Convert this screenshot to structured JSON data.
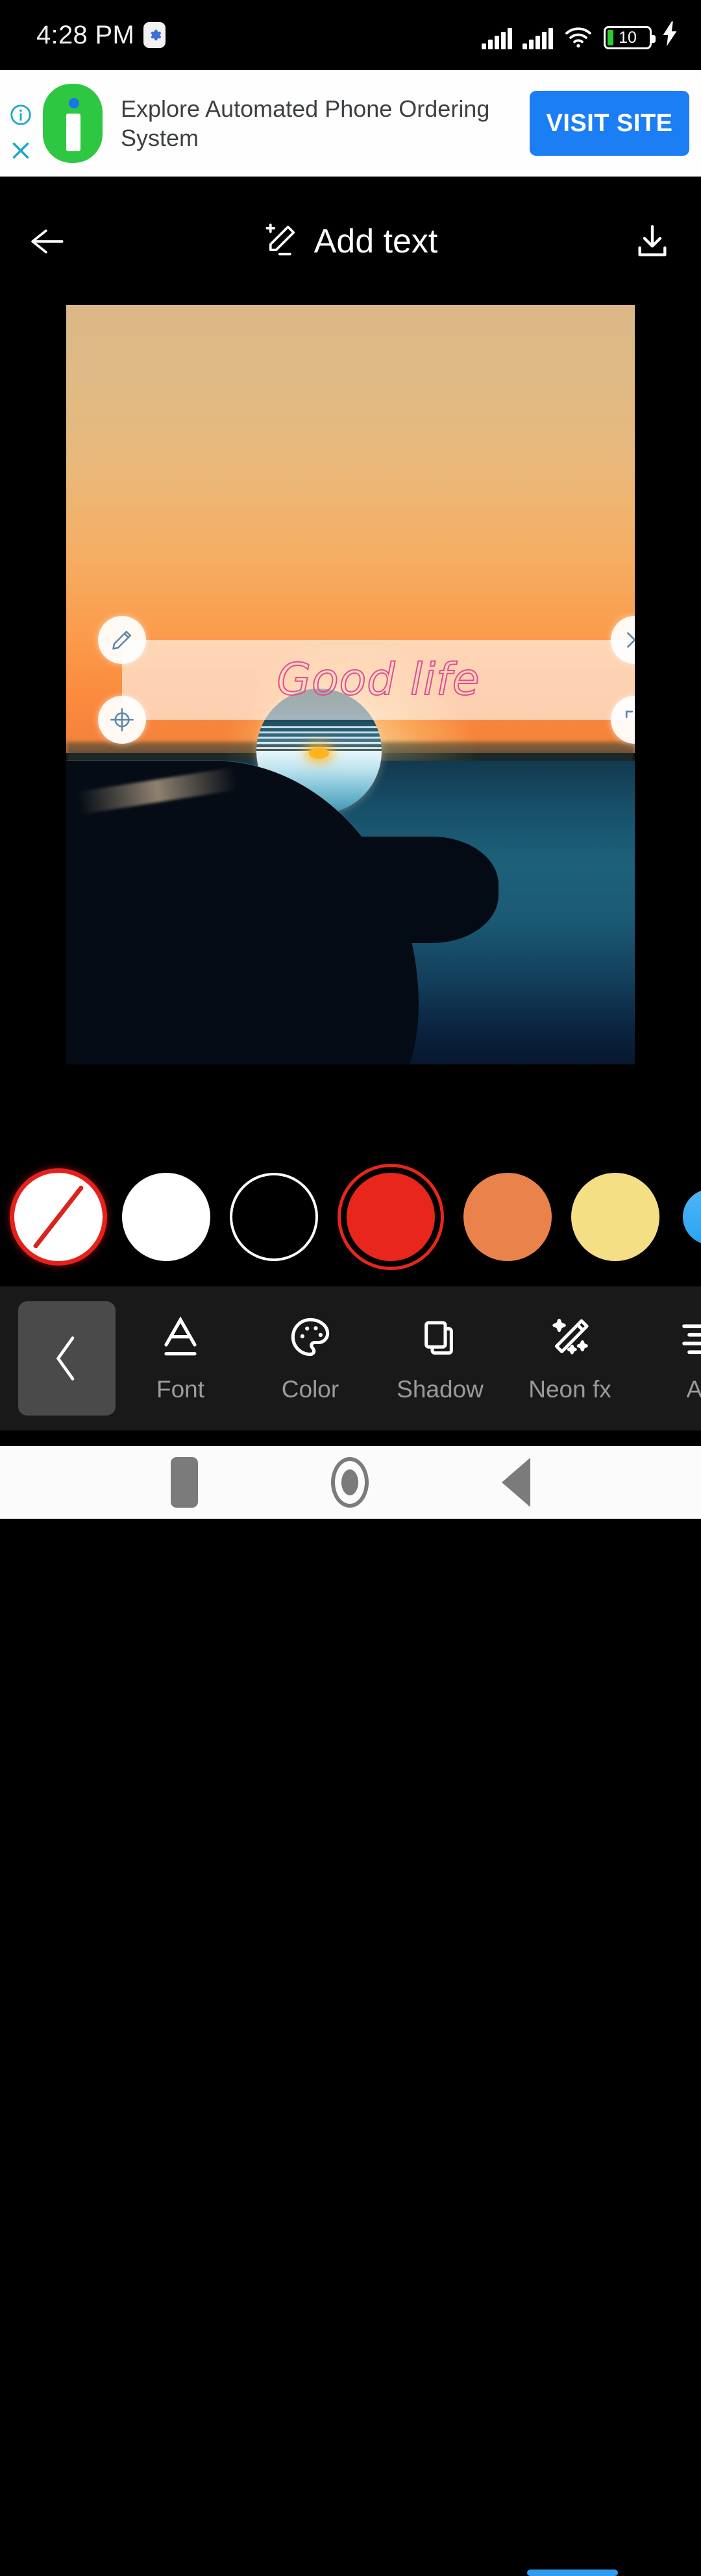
{
  "status_bar": {
    "time": "4:28 PM",
    "gear_icon": "gear-icon",
    "signal_1": "signal-bars-icon",
    "signal_2": "signal-bars-icon",
    "wifi": "wifi-icon",
    "battery_level": "10",
    "charging_icon": "lightning-bolt-icon"
  },
  "ad_banner": {
    "info_icon": "info-icon",
    "close_icon": "close-icon",
    "advertiser_logo": "infobip-logo-icon",
    "headline": "Explore Automated Phone Ordering System",
    "cta_label": "VISIT SITE"
  },
  "app_header": {
    "back_icon": "arrow-left-icon",
    "title_icon": "add-text-pencil-icon",
    "title": "Add text",
    "save_icon": "download-icon"
  },
  "canvas": {
    "overlay_text": "Good life",
    "overlay_text_color": "#dd4e95",
    "overlay_box_color": "#ffffff",
    "handles": {
      "edit": "pencil-icon",
      "move": "move-crosshair-icon",
      "close": "close-x-icon",
      "resize": "resize-corner-icon"
    }
  },
  "color_palette": {
    "swatches": [
      {
        "name": "none",
        "label": "No color",
        "color": "#ffffff",
        "selected": false
      },
      {
        "name": "white",
        "label": "White",
        "color": "#ffffff",
        "selected": false
      },
      {
        "name": "black",
        "label": "Black",
        "color": "#000000",
        "selected": false
      },
      {
        "name": "red",
        "label": "Red",
        "color": "#e8261c",
        "selected": true
      },
      {
        "name": "orange",
        "label": "Orange",
        "color": "#e9834b",
        "selected": false
      },
      {
        "name": "yellow",
        "label": "Yellow",
        "color": "#f5df85",
        "selected": false
      }
    ],
    "next_icon": "chevron-right-icon",
    "next_color": "#2aa3f2"
  },
  "toolbar": {
    "back_icon": "chevron-left-icon",
    "items": [
      {
        "label": "Font",
        "icon": "font-letter-a-icon"
      },
      {
        "label": "Color",
        "icon": "palette-icon"
      },
      {
        "label": "Shadow",
        "icon": "layers-shadow-icon"
      },
      {
        "label": "Neon fx",
        "icon": "magic-wand-sparkle-icon"
      },
      {
        "label": "Ali",
        "icon": "text-align-icon"
      }
    ],
    "scroll_indicator_color": "#2f9cf0"
  },
  "nav_bar": {
    "recents_icon": "square-recents-icon",
    "home_icon": "circle-home-icon",
    "back_icon": "triangle-back-icon"
  }
}
